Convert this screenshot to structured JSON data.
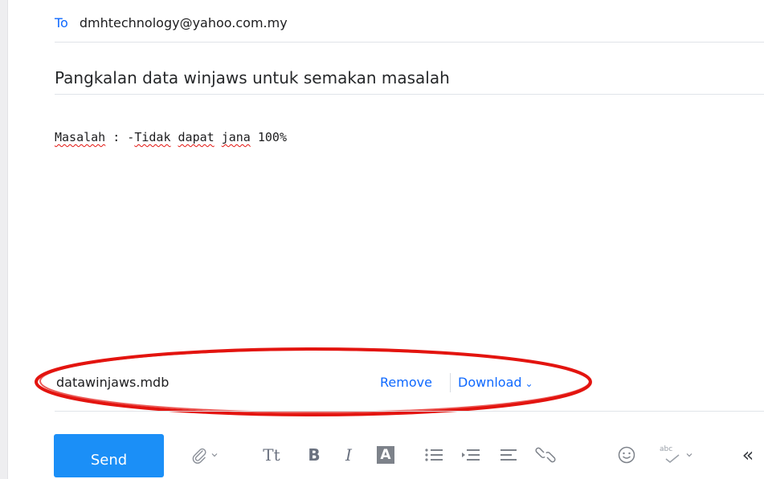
{
  "compose": {
    "to_label": "To",
    "to_address": "dmhtechnology@yahoo.com.my",
    "subject": "Pangkalan data winjaws untuk semakan masalah",
    "body": {
      "w1": "Masalah",
      "sep": " : -",
      "w2": "Tidak",
      "sp1": " ",
      "w3": "dapat",
      "sp2": " ",
      "w4": "jana",
      "tail": " 100%"
    }
  },
  "attachment": {
    "filename": "datawinjaws.mdb",
    "remove_label": "Remove",
    "download_label": "Download"
  },
  "toolbar": {
    "send_label": "Send",
    "text_size_glyph": "Tt",
    "bold_glyph": "B",
    "italic_glyph": "I",
    "color_glyph": "A",
    "more_glyph": "«",
    "spellcheck_glyph": "abc",
    "icons": [
      "attach-icon",
      "text-size-icon",
      "bold-icon",
      "italic-icon",
      "text-color-icon",
      "bullet-list-icon",
      "indent-icon",
      "align-icon",
      "link-icon",
      "emoji-icon",
      "spellcheck-icon",
      "collapse-icon"
    ]
  },
  "colors": {
    "accent": "#0f69ff",
    "send": "#1b8ff7",
    "annotation": "#e3140f"
  }
}
